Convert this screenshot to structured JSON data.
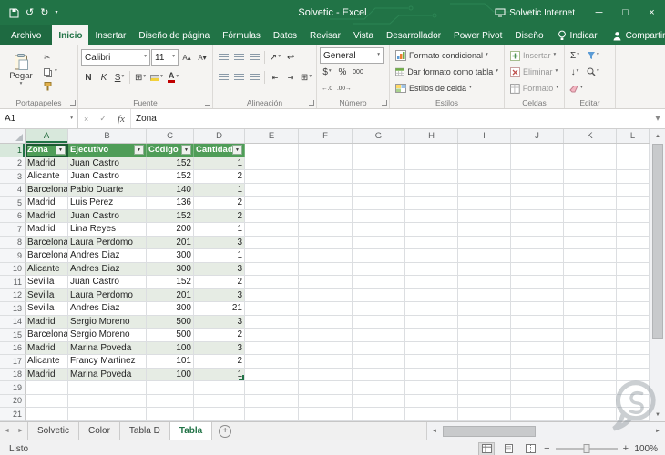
{
  "colors": {
    "excel_green": "#217346",
    "table_header_green": "#4f9d58",
    "banded_row": "#e6ece4",
    "selected_header": "#d8e8dc"
  },
  "titlebar": {
    "title": "Solvetic  -  Excel",
    "network_label": "Solvetic Internet"
  },
  "ribbon_tabs": {
    "file": "Archivo",
    "tabs": [
      "Inicio",
      "Insertar",
      "Diseño de página",
      "Fórmulas",
      "Datos",
      "Revisar",
      "Vista",
      "Desarrollador",
      "Power Pivot",
      "Diseño"
    ],
    "active": "Inicio",
    "tell_me": "Indicar",
    "share": "Compartir"
  },
  "ribbon": {
    "paste_label": "Pegar",
    "clipboard_group": "Portapapeles",
    "font_family": "Calibri",
    "font_size": "11",
    "bold": "N",
    "italic": "K",
    "underline": "S",
    "font_group": "Fuente",
    "align_group": "Alineación",
    "number_format": "General",
    "currency": "$",
    "percent": "%",
    "thousands": "000",
    "number_group": "Número",
    "conditional_format": "Formato condicional",
    "format_as_table": "Dar formato como tabla",
    "cell_styles": "Estilos de celda",
    "styles_group": "Estilos",
    "insert": "Insertar",
    "delete": "Eliminar",
    "format": "Formato",
    "cells_group": "Celdas",
    "edit_group": "Editar"
  },
  "formula_bar": {
    "name_box": "A1",
    "fx": "fx",
    "content": "Zona"
  },
  "sheet": {
    "columns": [
      "A",
      "B",
      "C",
      "D",
      "E",
      "F",
      "G",
      "H",
      "I",
      "J",
      "K",
      "L"
    ],
    "visible_rows": 21,
    "selection": "A1",
    "table": {
      "headers": [
        "Zona",
        "Ejecutivo",
        "Código",
        "Cantidad"
      ],
      "rows": [
        [
          "Madrid",
          "Juan Castro",
          "152",
          "1"
        ],
        [
          "Alicante",
          "Juan Castro",
          "152",
          "2"
        ],
        [
          "Barcelona",
          "Pablo Duarte",
          "140",
          "1"
        ],
        [
          "Madrid",
          "Luis Perez",
          "136",
          "2"
        ],
        [
          "Madrid",
          "Juan Castro",
          "152",
          "2"
        ],
        [
          "Madrid",
          "Lina Reyes",
          "200",
          "1"
        ],
        [
          "Barcelona",
          "Laura Perdomo",
          "201",
          "3"
        ],
        [
          "Barcelona",
          "Andres Diaz",
          "300",
          "1"
        ],
        [
          "Alicante",
          "Andres Diaz",
          "300",
          "3"
        ],
        [
          "Sevilla",
          "Juan Castro",
          "152",
          "2"
        ],
        [
          "Sevilla",
          "Laura Perdomo",
          "201",
          "3"
        ],
        [
          "Sevilla",
          "Andres Diaz",
          "300",
          "21"
        ],
        [
          "Madrid",
          "Sergio Moreno",
          "500",
          "3"
        ],
        [
          "Barcelona",
          "Sergio Moreno",
          "500",
          "2"
        ],
        [
          "Madrid",
          "Marina Poveda",
          "100",
          "3"
        ],
        [
          "Alicante",
          "Francy Martinez",
          "101",
          "2"
        ],
        [
          "Madrid",
          "Marina Poveda",
          "100",
          "1"
        ]
      ]
    }
  },
  "sheet_tabs": {
    "tabs": [
      "Solvetic",
      "Color",
      "Tabla D",
      "Tabla"
    ],
    "active": "Tabla"
  },
  "status_bar": {
    "ready": "Listo",
    "zoom": "100%"
  },
  "icons": {
    "caret_down": "▾",
    "filter": "▼",
    "undo": "↺",
    "redo": "↻",
    "minimize": "─",
    "maximize": "□",
    "close": "×",
    "cancel": "×",
    "enter": "✓",
    "scroll_up": "▲",
    "scroll_down": "▼",
    "scroll_left": "◄",
    "scroll_right": "►",
    "tab_nav_left": "◄",
    "tab_nav_right": "►",
    "add_sheet": "+",
    "autosum": "Σ",
    "cut": "✂",
    "fill_down": "↓",
    "orientation": "↗",
    "wrap": "↩",
    "indent_less": "⇤",
    "indent_more": "⇥",
    "merge": "⊞",
    "borders": "⊞",
    "increase_font": "A▴",
    "decrease_font": "A▾",
    "inc_decimal": "←.0",
    "dec_decimal": ".00→",
    "zoom_out": "−",
    "zoom_in": "+",
    "font_color": "A"
  }
}
